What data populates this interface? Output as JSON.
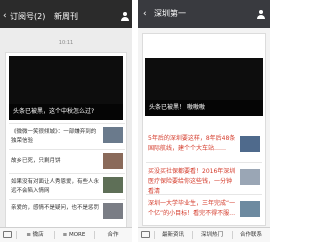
{
  "left": {
    "nav": {
      "back": "‹",
      "back_label": "订阅号",
      "count": "(2)",
      "title": "新周刊"
    },
    "time": "10:11",
    "hero": {
      "caption": "头条已被黑，这个中秋怎么过?"
    },
    "items": [
      {
        "text": "《微微一笑很倾城》：一部嫌弃到的独荣信验"
      },
      {
        "text": "故乡已死，只剩月饼"
      },
      {
        "text": "如果没有对面让人秀恩爱，有些人永远不会陷入情网"
      },
      {
        "text": "亲爱的，感情不是疑问，也不是惩罚"
      }
    ],
    "bottom": [
      "微店",
      "MORE",
      "合作"
    ]
  },
  "right": {
    "nav": {
      "back": "‹",
      "title": "深圳第一"
    },
    "hero": {
      "caption": "头条已被黑！ 嗷嗷嗷"
    },
    "items": [
      {
        "text": "5年后的深圳要这样，8年后48条国际航线，建个个大车站……"
      },
      {
        "text": "买没买社保都要看！2016年深圳医疗保险要给你这些钱，一分钟看清"
      },
      {
        "text": "深圳一大学毕业生，三年完成“一个亿”的小目标！看完不得不服…"
      }
    ],
    "bottom": [
      "最新资讯",
      "深圳热门",
      "合作联系"
    ]
  }
}
